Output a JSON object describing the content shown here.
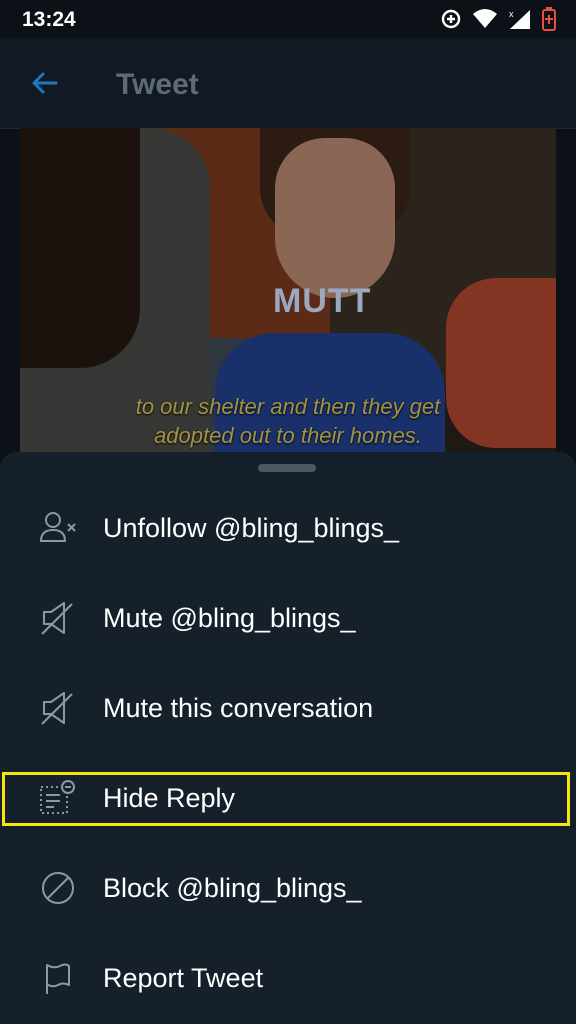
{
  "status_bar": {
    "time": "13:24"
  },
  "app_bar": {
    "title": "Tweet"
  },
  "media": {
    "shirt_text": "MUTT",
    "caption_line1": "to our shelter and then they get",
    "caption_line2": "adopted out to their homes."
  },
  "sheet": {
    "items": [
      {
        "label": "Unfollow @bling_blings_",
        "icon": "unfollow-user-icon"
      },
      {
        "label": "Mute @bling_blings_",
        "icon": "mute-speaker-icon"
      },
      {
        "label": "Mute this conversation",
        "icon": "mute-conversation-icon"
      },
      {
        "label": "Hide Reply",
        "icon": "hide-reply-icon"
      },
      {
        "label": "Block @bling_blings_",
        "icon": "block-icon"
      },
      {
        "label": "Report Tweet",
        "icon": "flag-icon"
      }
    ]
  },
  "colors": {
    "sheet_bg": "#15202b",
    "highlight": "#f5e50b",
    "accent": "#1d9bf0"
  }
}
